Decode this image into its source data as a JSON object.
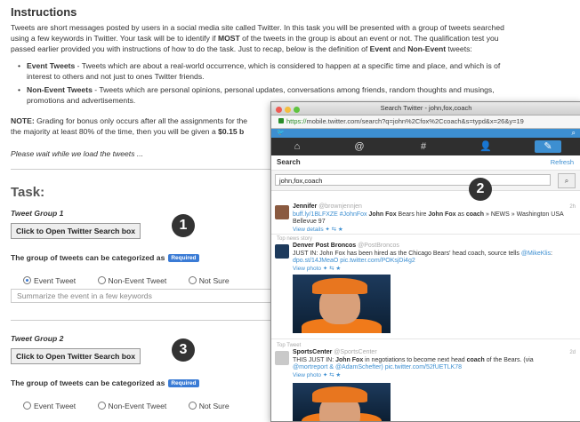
{
  "instructions": {
    "heading": "Instructions",
    "para1_line1": "Tweets are short messages posted by users in a social media site called Twitter. In this task you will be presented with a group of tweets searched",
    "para1_line2_pre": "using a few keywords in Twitter. Your task will be to identify if ",
    "para1_most": "MOST",
    "para1_line2_post": " of the tweets in the group is about an event or not. The qualification test you",
    "para1_line3_pre": "passed earlier provided you with instructions of how to do the task. Just to recap, below is the definition of ",
    "para1_event": "Event",
    "para1_and": " and ",
    "para1_nonevent": "Non-Event",
    "para1_end": " tweets:",
    "event_title": "Event Tweets",
    "event_text_1": " - Tweets which are about a real-world occurrence, which is considered to happen at a specific time and place, and which is of",
    "event_text_2": "interest to others and not just to ones Twitter friends.",
    "nonevent_title": "Non-Event Tweets",
    "nonevent_text_1": " - Tweets which are personal opinions, personal updates, conversations among friends, random thoughts and musings,",
    "nonevent_text_2": "promotions and advertisements.",
    "note_label": "NOTE:",
    "note_text_1": " Grading for bonus only occurs after all the assignments for the",
    "note_text_2_pre": "the majority at least 80% of the time, then you will be given a ",
    "note_bonus": "$0.15 b",
    "wait_text": "Please wait while we load the tweets ..."
  },
  "task": {
    "heading": "Task:",
    "groups": [
      {
        "title": "Tweet Group 1",
        "button": "Click to Open Twitter Search box",
        "question": "The group of tweets can be categorized as",
        "required": "Required",
        "options": [
          "Event Tweet",
          "Non-Event Tweet",
          "Not Sure"
        ],
        "selected": "Event Tweet",
        "summary_placeholder": "Summarize the event in a few keywords"
      },
      {
        "title": "Tweet Group 2",
        "button": "Click to Open Twitter Search box",
        "question": "The group of tweets can be categorized as",
        "required": "Required",
        "options": [
          "Event Tweet",
          "Non-Event Tweet",
          "Not Sure"
        ],
        "selected": ""
      }
    ]
  },
  "markers": [
    "1",
    "2",
    "3"
  ],
  "popup": {
    "window_title": "Search Twitter - john,fox,coach",
    "url_https": "https://",
    "url_rest": "mobile.twitter.com/search?q=john%2Cfox%2Ccoach&s=typd&x=26&y=19",
    "search_title": "Search",
    "refresh": "Refresh",
    "query": "john,fox,coach",
    "tweets": [
      {
        "name": "Jennifer",
        "handle": "@brownjennjen",
        "time": "2h",
        "link": "buff.ly/1BLFXZE #JohnFox",
        "text_bold1": " John Fox",
        "text_mid1": " Bears hire ",
        "text_bold2": "John Fox",
        "text_mid2": " as ",
        "text_bold3": "coach",
        "text_end": " » NEWS » Washington USA",
        "text_line2": "Bellevue 97",
        "meta": "View details  ✦  ⇆  ★"
      },
      {
        "tag": "Top news story",
        "name": "Denver Post Broncos",
        "handle": "@PostBroncos",
        "text_pre": "JUST IN: John Fox has been hired as the Chicago Bears' head coach, source tells ",
        "mention": "@MikeKlis",
        "text_end": ":",
        "link": "dpo.st/14JMeaO pic.twitter.com/POKsjDi4g2",
        "meta": "View photo  ✦  ⇆  ★"
      },
      {
        "tag": "Top Tweet",
        "name": "SportsCenter",
        "handle": "@SportsCenter",
        "time": "2d",
        "text_pre": "THIS JUST IN: ",
        "text_bold1": "John Fox",
        "text_mid1": " in negotiations to become next head ",
        "text_bold2": "coach",
        "text_end": " of the Bears. (via",
        "link2": "@mortreport & @AdamSchefter) pic.twitter.com/52fUETLK78",
        "meta": "View photo  ✦  ⇆  ★"
      }
    ]
  },
  "icons": {
    "home": "home-icon",
    "connect": "at-icon",
    "discover": "hash-icon",
    "me": "person-icon",
    "compose": "compose-icon",
    "search": "search-icon"
  },
  "colors": {
    "twitter_blue": "#3d8fd1",
    "required_badge": "#3a7bd5",
    "marker": "#333333"
  }
}
